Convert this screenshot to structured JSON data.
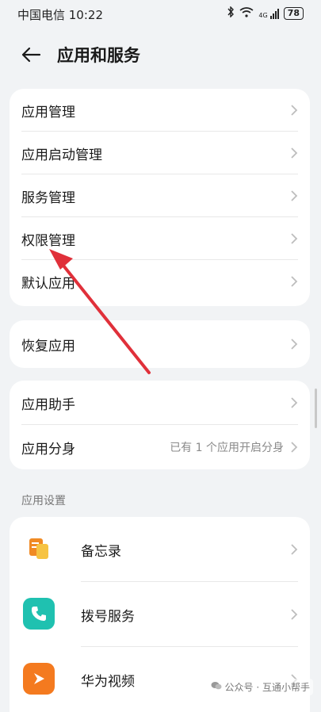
{
  "status": {
    "carrier_time": "中国电信 10:22",
    "signal": "4G",
    "battery": "78"
  },
  "header": {
    "title": "应用和服务"
  },
  "group1": [
    "应用管理",
    "应用启动管理",
    "服务管理",
    "权限管理",
    "默认应用"
  ],
  "group2": [
    "恢复应用"
  ],
  "group3": {
    "helper": "应用助手",
    "clone": "应用分身",
    "clone_value": "已有 1 个应用开启分身"
  },
  "section": {
    "label": "应用设置"
  },
  "apps": [
    {
      "label": "备忘录",
      "icon": "memo-icon",
      "color": "#f08a24"
    },
    {
      "label": "拨号服务",
      "icon": "phone-icon",
      "color": "#1fc1b0"
    },
    {
      "label": "华为视频",
      "icon": "video-play-icon",
      "color": "#f47a1f"
    }
  ],
  "watermark": "公众号 · 互通小帮手",
  "colors": {
    "arrow": "#e0303a",
    "background": "#f1f3f5"
  }
}
